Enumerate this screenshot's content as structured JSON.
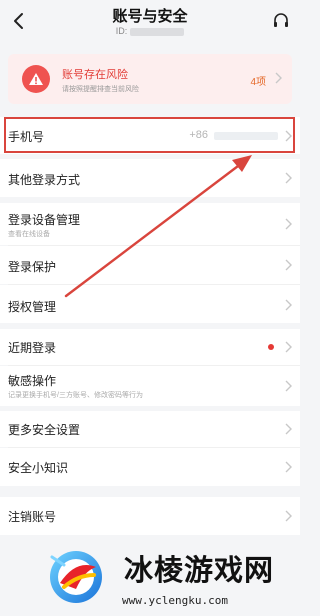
{
  "header": {
    "title": "账号与安全",
    "id_label": "ID:"
  },
  "risk": {
    "title": "账号存在风险",
    "desc": "请按照提醒排查当前风险",
    "count": "4项"
  },
  "rows": {
    "phone": {
      "label": "手机号",
      "value": "+86"
    },
    "other_login": {
      "label": "其他登录方式"
    },
    "device": {
      "label": "登录设备管理",
      "sub": "查看在线设备"
    },
    "protect": {
      "label": "登录保护"
    },
    "auth": {
      "label": "授权管理"
    },
    "recent": {
      "label": "近期登录"
    },
    "sensitive": {
      "label": "敏感操作",
      "sub": "记录更换手机号/三方账号、修改密码等行为"
    },
    "more": {
      "label": "更多安全设置"
    },
    "tips": {
      "label": "安全小知识"
    },
    "cancel": {
      "label": "注销账号"
    }
  },
  "watermark": {
    "text": "冰棱游戏网",
    "url": "www.yclengku.com"
  },
  "colors": {
    "risk_red": "#e23b35",
    "highlight": "#d9453d",
    "arrow": "#d9453d"
  }
}
